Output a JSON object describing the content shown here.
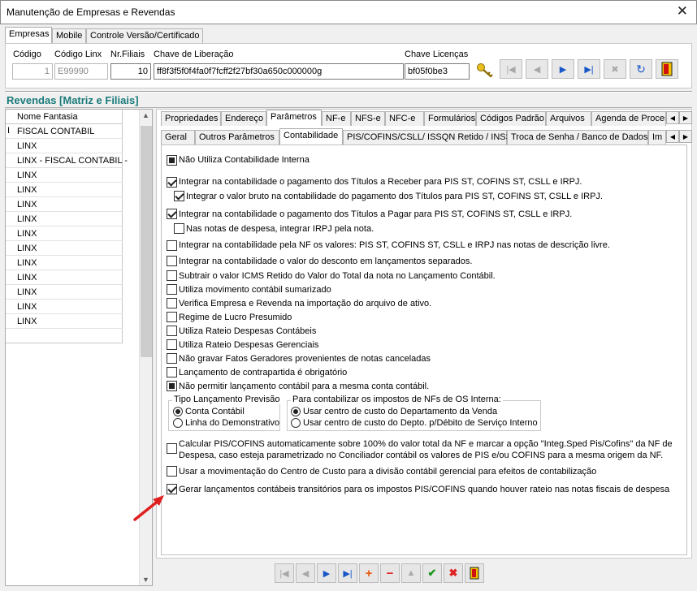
{
  "window": {
    "title": "Manutenção de Empresas e Revendas"
  },
  "top_tabs": [
    "Empresas",
    "Mobile",
    "Controle Versão/Certificado"
  ],
  "fields": {
    "codigo_label": "Código",
    "codigo_value": "1",
    "codigo_linx_label": "Código Linx",
    "codigo_linx_value": "E99990",
    "nr_filiais_label": "Nr.Filiais",
    "nr_filiais_value": "10",
    "chave_liberacao_label": "Chave de Liberação",
    "chave_liberacao_value": "ff8f3f5f0f4fa0f7fcff2f27bf30a650c000000g",
    "chave_licencas_label": "Chave Licenças",
    "chave_licencas_value": "bf05f0be3"
  },
  "revendas": {
    "title": "Revendas [Matriz e Filiais]",
    "column": "Nome Fantasia",
    "rows": [
      "FISCAL CONTABIL",
      "LINX",
      "LINX - FISCAL CONTABIL -",
      "LINX",
      "LINX",
      "LINX",
      "LINX",
      "LINX",
      "LINX",
      "LINX",
      "LINX",
      "LINX",
      "LINX",
      "LINX"
    ]
  },
  "main_tabs": [
    "Propriedades",
    "Endereço",
    "Parâmetros",
    "NF-e",
    "NFS-e",
    "NFC-e",
    "Formulários",
    "Códigos Padrão",
    "Arquivos",
    "Agenda de Proces"
  ],
  "sub_tabs": [
    "Geral",
    "Outros Parâmetros",
    "Contabilidade",
    "PIS/COFINS/CSLL/ ISSQN Retido / INSS",
    "Troca de Senha / Banco de Dados",
    "Im"
  ],
  "options": [
    "Não Utiliza Contabilidade Interna",
    "Integrar na contabilidade o pagamento dos Títulos a Receber para PIS ST, COFINS ST, CSLL e IRPJ.",
    "Integrar o valor bruto na contabilidade do pagamento dos Títulos para PIS ST, COFINS ST, CSLL e IRPJ.",
    "Integrar na contabilidade o pagamento dos Títulos a Pagar para PIS ST, COFINS ST, CSLL e IRPJ.",
    "Nas notas de despesa, integrar IRPJ pela nota.",
    "Integrar na contabilidade pela NF os valores: PIS ST, COFINS ST, CSLL e IRPJ nas notas de descrição livre.",
    "Integrar na contabilidade o valor do desconto em lançamentos separados.",
    "Subtrair o valor ICMS Retido do Valor do Total da nota no Lançamento Contábil.",
    "Utiliza movimento contábil sumarizado",
    "Verifica Empresa e Revenda na importação do arquivo de ativo.",
    "Regime de Lucro Presumido",
    "Utiliza Rateio Despesas Contábeis",
    "Utiliza Rateio Despesas Gerenciais",
    "Não gravar Fatos Geradores provenientes de notas canceladas",
    "Lançamento de contrapartida é obrigatório",
    "Não permitir lançamento contábil para a mesma conta contábil."
  ],
  "group1": {
    "title": "Tipo Lançamento Previsão",
    "opt1": "Conta Contábil",
    "opt2": "Linha do Demonstrativo"
  },
  "group2": {
    "title": "Para contabilizar os impostos de NFs de OS Interna:",
    "opt1": "Usar centro de custo do Departamento da Venda",
    "opt2": "Usar centro de custo do Depto. p/Débito de Serviço Interno"
  },
  "option_calc_line1": "Calcular PIS/COFINS automaticamente sobre 100% do valor total da NF e marcar a opção \"Integ.Sped Pis/Cofins\" da NF de",
  "option_calc_line2": "Despesa, caso esteja parametrizado no Conciliador contábil os valores de PIS e/ou COFINS para a mesma origem da NF.",
  "option_centro_custo": "Usar a movimentação do Centro de Custo para a divisão contábil gerencial para efeitos de contabilização",
  "option_transitorios": "Gerar lançamentos contábeis transitórios para os impostos PIS/COFINS quando houver rateio nas notas fiscais de despesa",
  "colors": {
    "accent_blue": "#1756c8",
    "revendas_title": "#1a7a7a",
    "arrow_red": "#e02020"
  }
}
